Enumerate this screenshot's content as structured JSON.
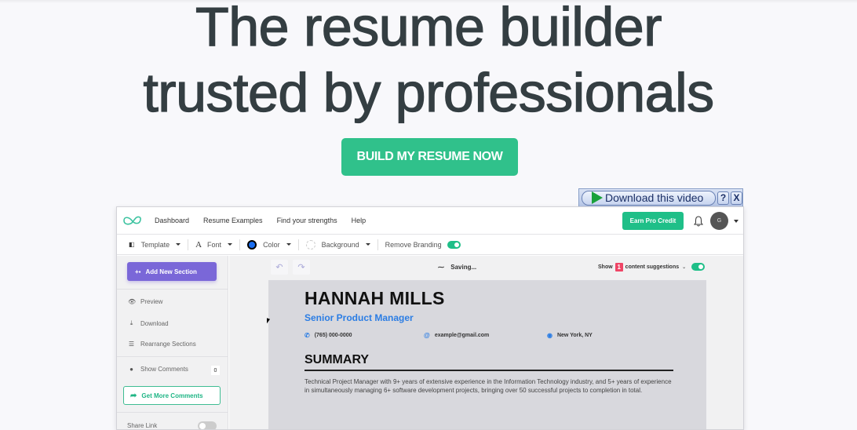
{
  "hero": {
    "title_line1": "The resume builder",
    "title_line2": "trusted by professionals",
    "cta_label": "BUILD MY RESUME NOW"
  },
  "download_overlay": {
    "label": "Download this video",
    "help": "?",
    "close": "X"
  },
  "app": {
    "nav": {
      "links": [
        "Dashboard",
        "Resume Examples",
        "Find your strengths",
        "Help"
      ],
      "earn_label": "Earn Pro Credit",
      "avatar_initial": "G"
    },
    "toolbar": {
      "template": "Template",
      "font": "Font",
      "color": "Color",
      "background": "Background",
      "remove_branding": "Remove Branding",
      "remove_branding_on": true
    },
    "sidebar": {
      "add_section": "Add New Section",
      "preview": "Preview",
      "download": "Download",
      "rearrange": "Rearrange Sections",
      "show_comments": "Show Comments",
      "comments_count": "0",
      "get_more_comments": "Get More Comments",
      "share_link": "Share Link",
      "share_link_on": false
    },
    "canvas": {
      "saving": "Saving...",
      "suggest_prefix": "Show",
      "suggest_count": "1",
      "suggest_suffix": "content suggestions",
      "suggestions_on": true
    },
    "resume": {
      "name": "HANNAH MILLS",
      "title": "Senior Product Manager",
      "phone": "(765) 000-0000",
      "email": "example@gmail.com",
      "location": "New York, NY",
      "summary_heading": "SUMMARY",
      "summary_text": "Technical Project Manager with 9+ years of extensive experience in the Information Technology industry, and 5+ years of experience in simultaneously managing 6+ software development projects, bringing over 50 successful projects to completion in total."
    }
  },
  "colors": {
    "cta_green": "#30c18b",
    "brand_green": "#1fbf88",
    "purple": "#7a67d8",
    "resume_blue": "#2b7de4",
    "badge_red": "#ef4566"
  }
}
